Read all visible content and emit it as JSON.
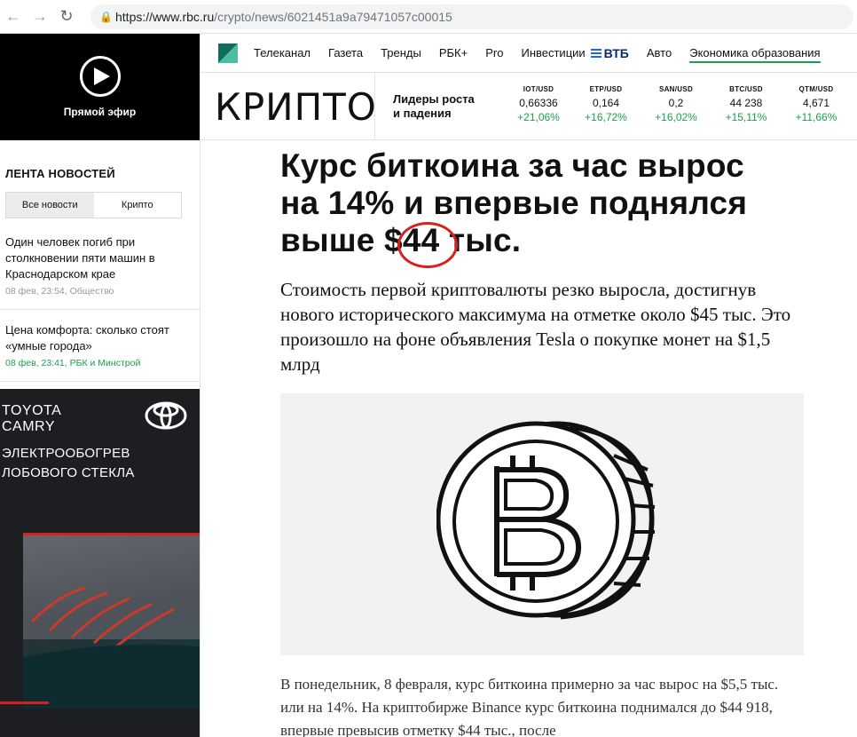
{
  "browser": {
    "url_domain": "https://www.rbc.ru",
    "url_path": "/crypto/news/6021451a9a79471057c00015"
  },
  "live": {
    "label": "Прямой эфир"
  },
  "nav": {
    "items": [
      "Телеканал",
      "Газета",
      "Тренды",
      "РБК+",
      "Pro"
    ],
    "invest": "Инвестиции",
    "vtb": "ВТБ",
    "auto": "Авто",
    "edu": "Экономика образования"
  },
  "section": {
    "title": "КРИПТО"
  },
  "leaders": {
    "line1": "Лидеры роста",
    "line2": "и падения"
  },
  "tickers": [
    {
      "pair": "IOT/USD",
      "value": "0,66336",
      "change": "+21,06%"
    },
    {
      "pair": "ETP/USD",
      "value": "0,164",
      "change": "+16,72%"
    },
    {
      "pair": "SAN/USD",
      "value": "0,2",
      "change": "+16,02%"
    },
    {
      "pair": "BTC/USD",
      "value": "44 238",
      "change": "+15,11%"
    },
    {
      "pair": "QTM/USD",
      "value": "4,671",
      "change": "+11,66%"
    }
  ],
  "feed": {
    "title": "ЛЕНТА НОВОСТЕЙ",
    "tabs": [
      "Все новости",
      "Крипто"
    ],
    "items": [
      {
        "title": "Один человек погиб при столкновении пяти машин в Краснодарском крае",
        "meta": "08 фев, 23:54, Общество"
      },
      {
        "title": "Цена комфорта: сколько стоят «умные города»",
        "meta": "08 фев, 23:41, РБК и Минстрой"
      }
    ]
  },
  "ad": {
    "brand1": "TOYOTA",
    "brand2": "CAMRY",
    "text1": "ЭЛЕКТРООБОГРЕВ",
    "text2": "ЛОБОВОГО СТЕКЛА"
  },
  "article": {
    "headline_pre": "Курс биткоина за час вырос на 14% и впервые поднялся выше $",
    "headline_num": "44",
    "headline_post": " тыс.",
    "subtitle": "Стоимость первой криптовалюты резко выросла, достигнув нового исторического максимума на отметке около $45 тыс. Это произошло на фоне объявления Tesla о покупке монет на $1,5 млрд",
    "body": "В понедельник, 8 февраля, курс биткоина примерно за час вырос на $5,5 тыс. или на 14%. На криптобирже Binance курс биткоина поднимался до $44 918, впервые превысив отметку $44 тыс., после"
  },
  "colors": {
    "green": "#1a9f4e",
    "red_circle": "#d9201f",
    "vtb_blue": "#0a2973"
  }
}
